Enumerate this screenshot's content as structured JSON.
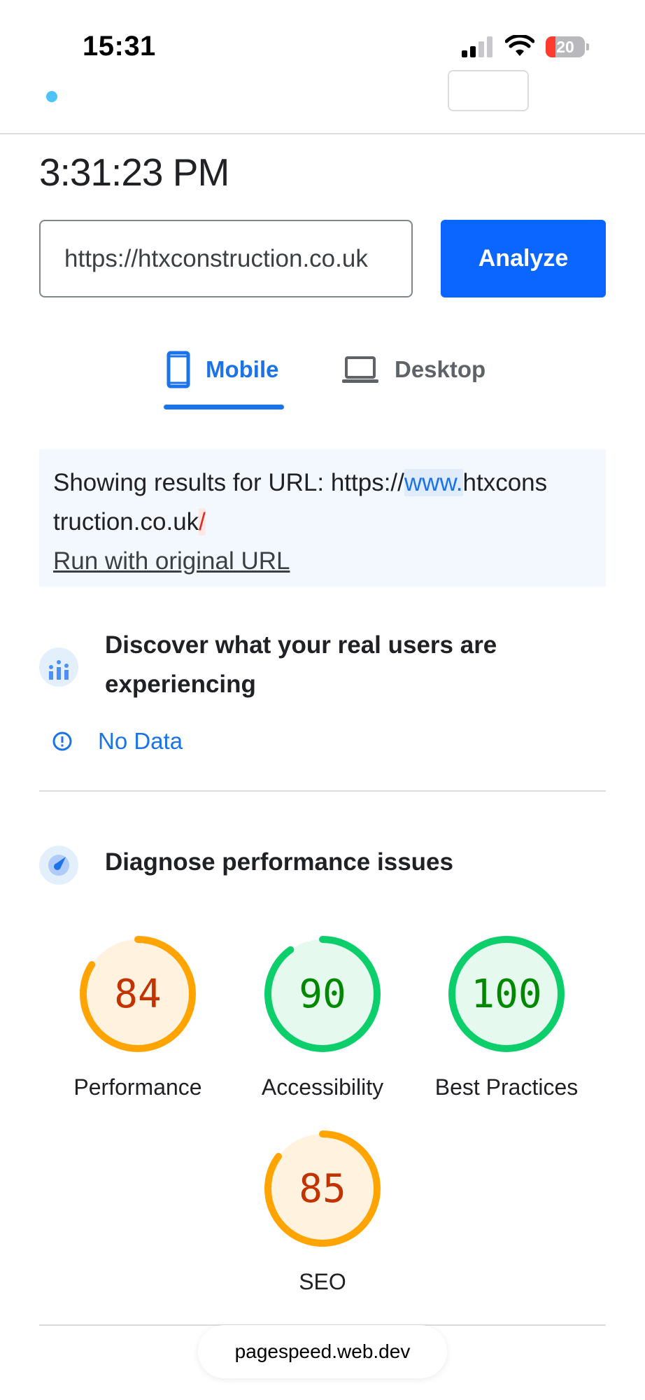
{
  "status_bar": {
    "time": "15:31",
    "battery_level": "20",
    "signal_bars_active": 2,
    "signal_bars_total": 4
  },
  "report": {
    "time": "3:31:23 PM"
  },
  "url_input": {
    "value": "https://htxconstruction.co.uk"
  },
  "analyze_label": "Analyze",
  "tabs": {
    "mobile": "Mobile",
    "desktop": "Desktop",
    "active": "mobile"
  },
  "url_notice": {
    "prefix": "Showing results for URL: https://",
    "highlight": "www.",
    "middle": "htxcons",
    "line2": "truction.co.uk",
    "slash": "/",
    "run_link": "Run with original URL"
  },
  "field_data": {
    "title": "Discover what your real users are experiencing",
    "no_data": "No Data"
  },
  "diagnose": {
    "title": "Diagnose performance issues"
  },
  "scores": [
    {
      "label": "Performance",
      "score": 84,
      "color": "#ffa400",
      "fill": "#fff3e0",
      "text_color": "#c33300"
    },
    {
      "label": "Accessibility",
      "score": 90,
      "color": "#0cce6b",
      "fill": "#e6f9ee",
      "text_color": "#008800"
    },
    {
      "label": "Best Practices",
      "score": 100,
      "color": "#0cce6b",
      "fill": "#e6f9ee",
      "text_color": "#008800"
    },
    {
      "label": "SEO",
      "score": 85,
      "color": "#ffa400",
      "fill": "#fff3e0",
      "text_color": "#c33300"
    }
  ],
  "browser": {
    "domain": "pagespeed.web.dev"
  }
}
